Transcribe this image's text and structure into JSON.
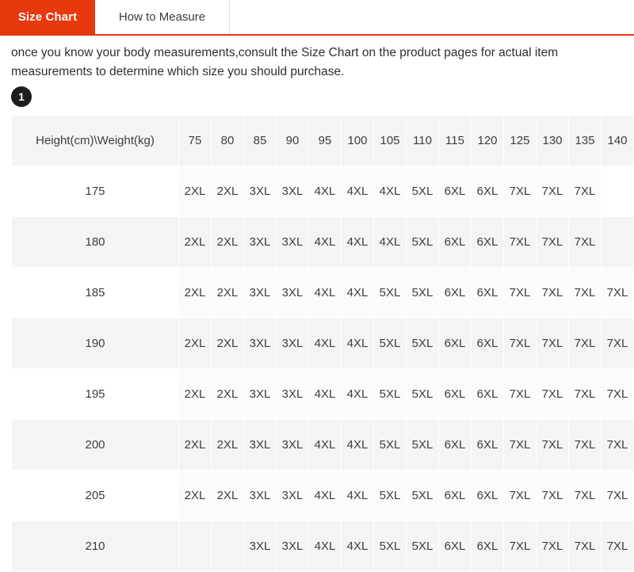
{
  "tabs": [
    {
      "label": "Size Chart",
      "active": true
    },
    {
      "label": "How to Measure",
      "active": false
    }
  ],
  "intro": {
    "text": "once you know your body measurements,consult the Size Chart on the product pages for actual item measurements to determine which size you should purchase.",
    "step_badge": "1"
  },
  "colors": {
    "accent": "#e8380d",
    "accent_border": "#e0380f",
    "badge": "#1d1d1d",
    "row_shade": "#f4f4f4",
    "header_cell": "#f4f4f4"
  },
  "chart_data": {
    "type": "table",
    "title": "Height(cm)\\Weight(kg)",
    "corner_header": "Height(cm)\\Weight(kg)",
    "xlabel": "Weight(kg)",
    "ylabel": "Height(cm)",
    "categories": [
      "75",
      "80",
      "85",
      "90",
      "95",
      "100",
      "105",
      "110",
      "115",
      "120",
      "125",
      "130",
      "135",
      "140"
    ],
    "row_labels": [
      "175",
      "180",
      "185",
      "190",
      "195",
      "200",
      "205",
      "210"
    ],
    "rows": [
      {
        "label": "175",
        "values": [
          "2XL",
          "2XL",
          "3XL",
          "3XL",
          "4XL",
          "4XL",
          "4XL",
          "5XL",
          "6XL",
          "6XL",
          "7XL",
          "7XL",
          "7XL",
          ""
        ]
      },
      {
        "label": "180",
        "values": [
          "2XL",
          "2XL",
          "3XL",
          "3XL",
          "4XL",
          "4XL",
          "4XL",
          "5XL",
          "6XL",
          "6XL",
          "7XL",
          "7XL",
          "7XL",
          ""
        ]
      },
      {
        "label": "185",
        "values": [
          "2XL",
          "2XL",
          "3XL",
          "3XL",
          "4XL",
          "4XL",
          "5XL",
          "5XL",
          "6XL",
          "6XL",
          "7XL",
          "7XL",
          "7XL",
          "7XL"
        ]
      },
      {
        "label": "190",
        "values": [
          "2XL",
          "2XL",
          "3XL",
          "3XL",
          "4XL",
          "4XL",
          "5XL",
          "5XL",
          "6XL",
          "6XL",
          "7XL",
          "7XL",
          "7XL",
          "7XL"
        ]
      },
      {
        "label": "195",
        "values": [
          "2XL",
          "2XL",
          "3XL",
          "3XL",
          "4XL",
          "4XL",
          "5XL",
          "5XL",
          "6XL",
          "6XL",
          "7XL",
          "7XL",
          "7XL",
          "7XL"
        ]
      },
      {
        "label": "200",
        "values": [
          "2XL",
          "2XL",
          "3XL",
          "3XL",
          "4XL",
          "4XL",
          "5XL",
          "5XL",
          "6XL",
          "6XL",
          "7XL",
          "7XL",
          "7XL",
          "7XL"
        ]
      },
      {
        "label": "205",
        "values": [
          "2XL",
          "2XL",
          "3XL",
          "3XL",
          "4XL",
          "4XL",
          "5XL",
          "5XL",
          "6XL",
          "6XL",
          "7XL",
          "7XL",
          "7XL",
          "7XL"
        ]
      },
      {
        "label": "210",
        "values": [
          "",
          "",
          "3XL",
          "3XL",
          "4XL",
          "4XL",
          "5XL",
          "5XL",
          "6XL",
          "6XL",
          "7XL",
          "7XL",
          "7XL",
          "7XL"
        ]
      }
    ]
  }
}
